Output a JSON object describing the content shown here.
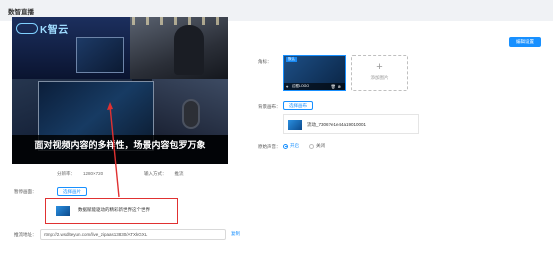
{
  "page": {
    "title": "数智直播"
  },
  "preview": {
    "logo_text": "K智云",
    "subtitle": "面对视频内容的多样性，场景内容包罗万象"
  },
  "meta": {
    "resolution_label": "分辨率：",
    "resolution_value": "1280×720",
    "input_label": "输入方式：",
    "input_value": "推流"
  },
  "wait_screen": {
    "label": "暂停画面：",
    "select_button": "选择画片",
    "file_name": "数据赋能驱动的精彩新世界这个世界"
  },
  "push_url": {
    "label": "推流地址：",
    "value": "rtmp://2.wsdlteyun.com/live_zipaas13830/ATXkGXL",
    "copy_label": "复制"
  },
  "right_panel": {
    "top_button": "编辑设置",
    "cover_label": "角标：",
    "cover_tag": "默认",
    "cover_logo_text": "边框LOGO",
    "add_label": "添加图片",
    "bg_label": "背景画布：",
    "bg_select_button": "选择画布",
    "bg_file_name": "流动_7306?e1e44a19010001",
    "sound_label": "原始声音：",
    "sound_on": "开启",
    "sound_off": "关闭"
  },
  "colors": {
    "accent": "#1890ff",
    "highlight": "#e03131",
    "page_bg": "#f0f2f5"
  }
}
